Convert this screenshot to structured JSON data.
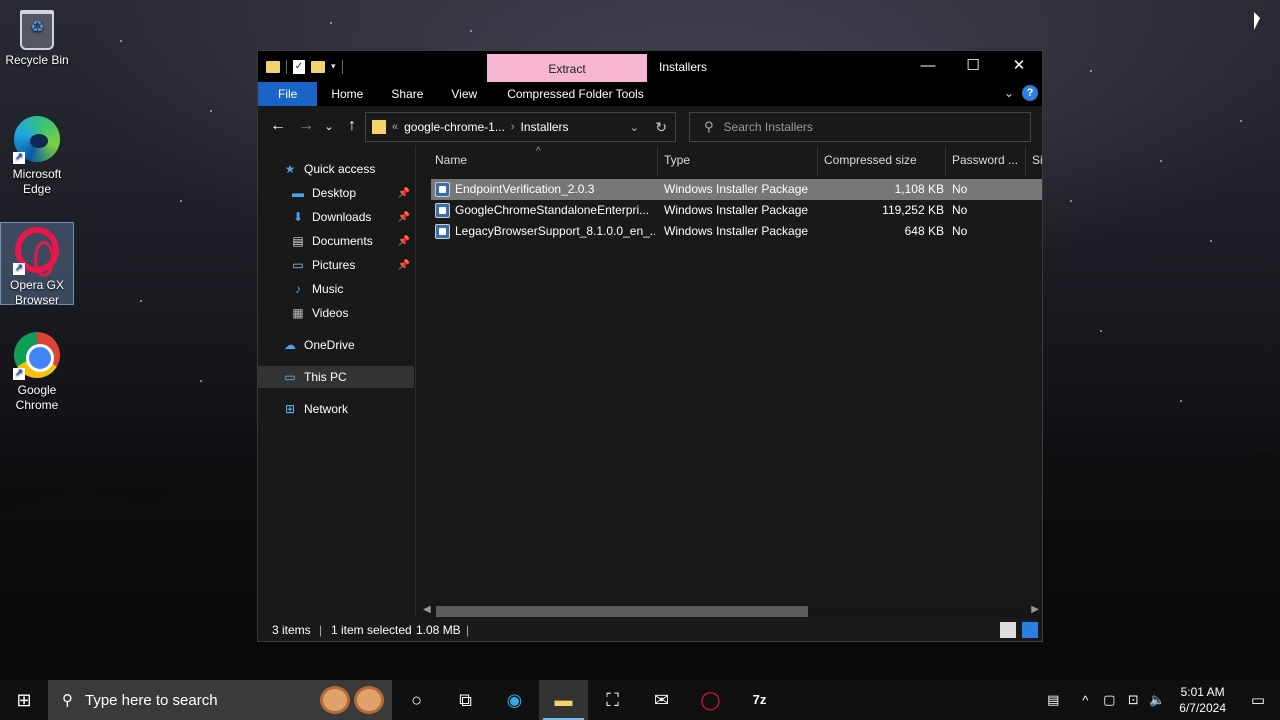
{
  "desktop": {
    "icons": [
      {
        "label": "Recycle Bin"
      },
      {
        "label": "Microsoft Edge"
      },
      {
        "label": "Opera GX Browser"
      },
      {
        "label": "Google Chrome"
      }
    ]
  },
  "window": {
    "title": "Installers",
    "contextual_tab": "Extract",
    "controls": {
      "minimize": "—",
      "maximize": "☐",
      "close": "✕"
    },
    "ribbon_tabs": [
      "File",
      "Home",
      "Share",
      "View",
      "Compressed Folder Tools"
    ],
    "address": {
      "overflow": "«",
      "crumbs": [
        "google-chrome-1...",
        "Installers"
      ]
    },
    "search_placeholder": "Search Installers",
    "nav": [
      {
        "label": "Quick access",
        "icon": "star-icon",
        "glyph": "★",
        "color": "#4aa3f0"
      },
      {
        "label": "Desktop",
        "icon": "desktop-icon",
        "glyph": "▬",
        "color": "#4aa3f0",
        "pinned": true
      },
      {
        "label": "Downloads",
        "icon": "download-icon",
        "glyph": "⬇",
        "color": "#4aa3f0",
        "pinned": true
      },
      {
        "label": "Documents",
        "icon": "document-icon",
        "glyph": "▤",
        "color": "#ddd",
        "pinned": true
      },
      {
        "label": "Pictures",
        "icon": "picture-icon",
        "glyph": "▭",
        "color": "#8fc4f0",
        "pinned": true
      },
      {
        "label": "Music",
        "icon": "music-icon",
        "glyph": "♪",
        "color": "#4aa3f0"
      },
      {
        "label": "Videos",
        "icon": "video-icon",
        "glyph": "▦",
        "color": "#bbb"
      },
      {
        "label": "OneDrive",
        "icon": "cloud-icon",
        "glyph": "☁",
        "color": "#4aa3f0"
      },
      {
        "label": "This PC",
        "icon": "computer-icon",
        "glyph": "▭",
        "color": "#6ab7f5",
        "selected": true
      },
      {
        "label": "Network",
        "icon": "network-icon",
        "glyph": "⊞",
        "color": "#6ab7f5"
      }
    ],
    "columns": [
      "Name",
      "Type",
      "Compressed size",
      "Password ...",
      "Si"
    ],
    "files": [
      {
        "name": "EndpointVerification_2.0.3",
        "type": "Windows Installer Package",
        "size": "1,108 KB",
        "password": "No",
        "selected": true
      },
      {
        "name": "GoogleChromeStandaloneEnterpri...",
        "type": "Windows Installer Package",
        "size": "119,252 KB",
        "password": "No"
      },
      {
        "name": "LegacyBrowserSupport_8.1.0.0_en_...",
        "type": "Windows Installer Package",
        "size": "648 KB",
        "password": "No"
      }
    ],
    "status": {
      "count": "3 items",
      "selection": "1 item selected",
      "size": "1.08 MB"
    }
  },
  "taskbar": {
    "search_placeholder": "Type here to search",
    "clock_time": "5:01 AM",
    "clock_date": "6/7/2024",
    "apps": [
      "cortana",
      "task-view",
      "edge",
      "file-explorer",
      "store",
      "mail",
      "opera",
      "7zip"
    ],
    "app_7zip_label": "7z"
  },
  "colors": {
    "accent": "#1a63c6",
    "contextual_tab": "#f6b6d2",
    "selected_row": "#777777"
  }
}
